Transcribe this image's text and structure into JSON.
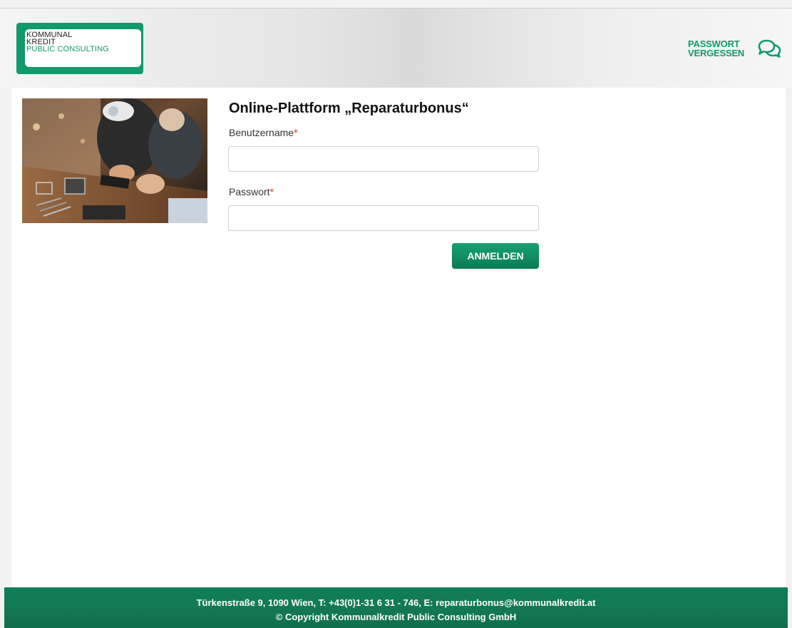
{
  "header": {
    "logo": {
      "line1": "KOMMUNAL",
      "line2": "KREDIT",
      "line3": "PUBLIC CONSULTING"
    },
    "forgot_password": {
      "line1": "PASSWORT",
      "line2": "VERGESSEN",
      "icon": "chat-bubbles-icon"
    }
  },
  "main": {
    "image": "repair-workshop-photo",
    "title": "Online-Plattform „Reparaturbonus“",
    "username_label": "Benutzername",
    "password_label": "Passwort",
    "required_marker": "*",
    "username_value": "",
    "password_value": "",
    "login_button": "ANMELDEN"
  },
  "footer": {
    "line1": "Türkenstraße 9, 1090 Wien, T: +43(0)1-31 6 31 - 746, E: reparaturbonus@kommunalkredit.at",
    "line2": "© Copyright Kommunalkredit Public Consulting GmbH"
  },
  "colors": {
    "brand_green": "#129a6b",
    "footer_green": "#137852",
    "required_red": "#d93025"
  }
}
